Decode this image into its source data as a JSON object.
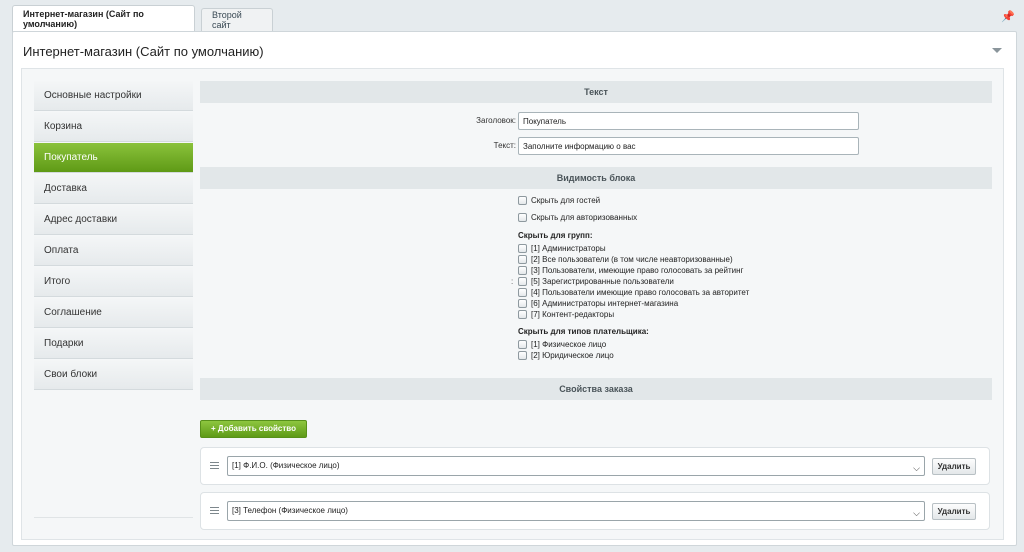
{
  "tabs": [
    {
      "label": "Интернет-магазин (Сайт по умолчанию)",
      "active": true
    },
    {
      "label": "Второй сайт",
      "active": false
    }
  ],
  "panel": {
    "title": "Интернет-магазин (Сайт по умолчанию)"
  },
  "sidebar": {
    "items": [
      {
        "label": "Основные настройки"
      },
      {
        "label": "Корзина"
      },
      {
        "label": "Покупатель"
      },
      {
        "label": "Доставка"
      },
      {
        "label": "Адрес доставки"
      },
      {
        "label": "Оплата"
      },
      {
        "label": "Итого"
      },
      {
        "label": "Соглашение"
      },
      {
        "label": "Подарки"
      },
      {
        "label": "Свои блоки"
      }
    ],
    "active": "Покупатель"
  },
  "text_section": {
    "title": "Текст",
    "header_label": "Заголовок:",
    "header_value": "Покупатель",
    "text_label": "Текст:",
    "text_value": "Заполните информацию о вас"
  },
  "visibility_section": {
    "title": "Видимость блока",
    "hide_guests": "Скрыть для гостей",
    "hide_authorized": "Скрыть для авторизованных",
    "groups_title": "Скрыть для групп:",
    "groups": [
      "[1] Администраторы",
      "[2] Все пользователи (в том числе неавторизованные)",
      "[3] Пользователи, имеющие право голосовать за рейтинг",
      "[5] Зарегистрированные пользователи",
      "[4] Пользователи имеющие право голосовать за авторитет",
      "[6] Администраторы интернет-магазина",
      "[7] Контент-редакторы"
    ],
    "colon": ":",
    "payer_title": "Скрыть для типов плательщика:",
    "payer_types": [
      "[1] Физическое лицо",
      "[2] Юридическое лицо"
    ]
  },
  "order_props_section": {
    "title": "Свойства заказа",
    "add_label": "+ Добавить свойство",
    "properties": [
      {
        "value": "[1] Ф.И.О. (Физическое лицо)",
        "delete_label": "Удалить"
      },
      {
        "value": "[3] Телефон (Физическое лицо)",
        "delete_label": "Удалить"
      }
    ]
  },
  "colors": {
    "accent_green": "#6aa81e",
    "section_header_bg": "#e2e7e9",
    "page_bg": "#e6ebee"
  },
  "icons": [
    "pin-icon",
    "collapse-arrow-icon",
    "drag-handle-icon",
    "chevron-down-icon",
    "checkbox"
  ]
}
